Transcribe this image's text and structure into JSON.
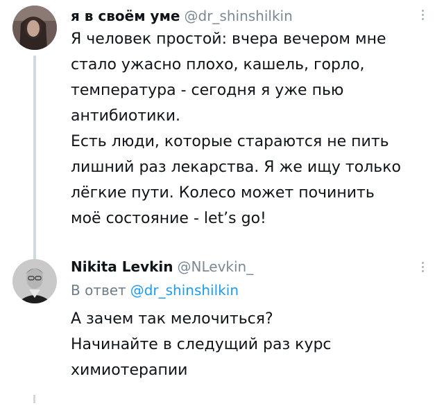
{
  "thread": {
    "tweets": [
      {
        "author": {
          "display_name": "я в своём уме",
          "handle": "@dr_shinshilkin"
        },
        "text_lines": [
          "Я человек простой: вчера вечером мне",
          "стало ужасно плохо, кашель, горло,",
          "температура - сегодня я уже пью",
          "антибиотики.",
          "Есть люди, которые стараются не пить",
          "лишний раз лекарства. Я же ищу только",
          "лёгкие пути. Колесо может починить",
          "моё состояние - let’s go!"
        ]
      },
      {
        "author": {
          "display_name": "Nikita Levkin",
          "handle": "@NLevkin_"
        },
        "reply_to": {
          "prefix": "В ответ",
          "mention": "@dr_shinshilkin"
        },
        "text_lines": [
          "А зачем так мелочиться?",
          "Начинайте в следущий раз курс",
          "химиотерапии"
        ]
      }
    ]
  },
  "colors": {
    "name_text": "#0f1419",
    "handle_text": "#7b8995",
    "mention_link": "#1d9bf0",
    "thread_line": "#cfd9de"
  }
}
